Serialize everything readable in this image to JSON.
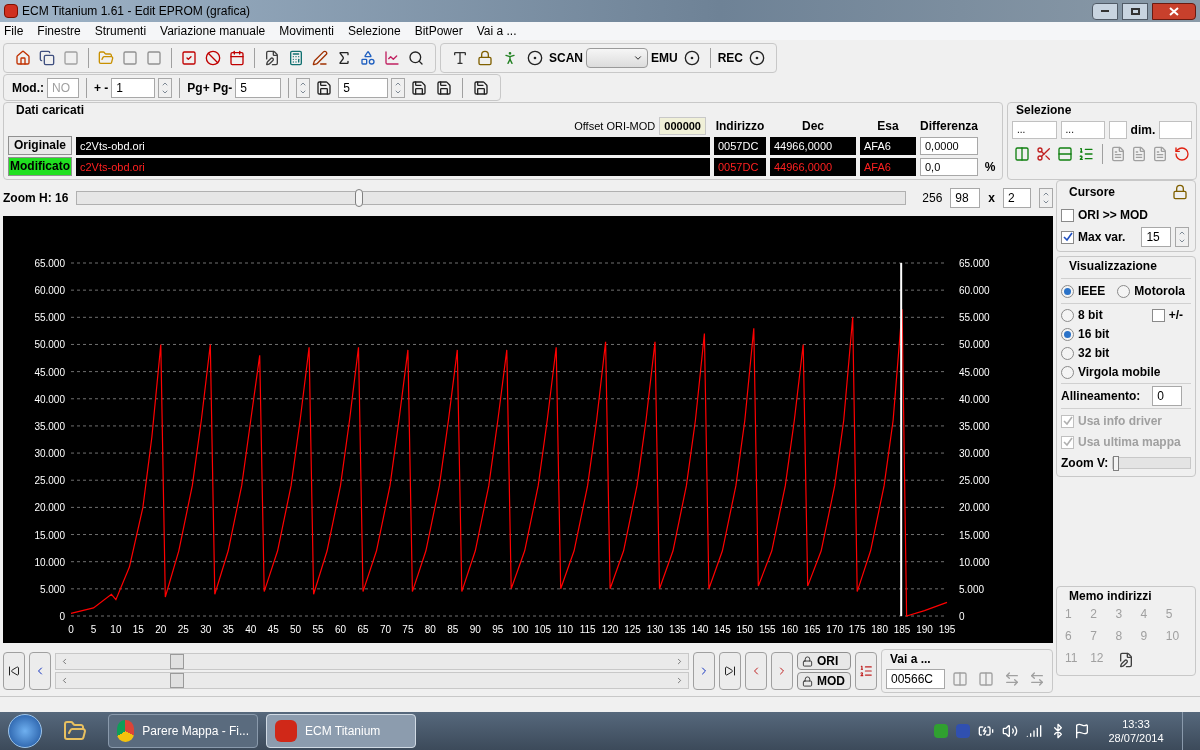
{
  "window": {
    "title": "ECM Titanium 1.61 - Edit EPROM (grafica)"
  },
  "menu": [
    "File",
    "Finestre",
    "Strumenti",
    "Variazione manuale",
    "Movimenti",
    "Selezione",
    "BitPower",
    "Vai a ..."
  ],
  "toolbar": {
    "scan_label": "SCAN",
    "emu_label": "EMU",
    "rec_label": "REC"
  },
  "toolbar2": {
    "mod_label": "Mod.:",
    "mod_value": "NO",
    "step_label": "+ -",
    "step_value": "1",
    "page_label": "Pg+ Pg-",
    "page_value": "5",
    "p_value": "5"
  },
  "loaded": {
    "title": "Dati caricati",
    "offset_label": "Offset ORI-MOD",
    "offset_value": "000000",
    "columns": [
      "Indirizzo",
      "Dec",
      "Esa",
      "Differenza"
    ],
    "rows": [
      {
        "kind": "original",
        "button": "Originale",
        "file": "c2Vts-obd.ori",
        "address": "0057DC",
        "dec": "44966,0000",
        "hex": "AFA6",
        "diff": "0,0000"
      },
      {
        "kind": "modified",
        "button": "Modificato",
        "file": "c2Vts-obd.ori",
        "address": "0057DC",
        "dec": "44966,0000",
        "hex": "AFA6",
        "diff": "0,0",
        "unit": "%"
      }
    ]
  },
  "selection": {
    "title": "Selezione",
    "from": "...",
    "to": "...",
    "dim_label": "dim."
  },
  "zoom": {
    "label": "Zoom H: 16",
    "level": 0.34,
    "max": "256",
    "value": "98",
    "x_label": "x",
    "factor": "2"
  },
  "chart_data": {
    "type": "line",
    "x": [
      0,
      5,
      9,
      10,
      13,
      16,
      18,
      20,
      21,
      24,
      27,
      29,
      31,
      32,
      35,
      38,
      40,
      42,
      43,
      46,
      49,
      51,
      53,
      54,
      57,
      60,
      62,
      64,
      65,
      68,
      71,
      73,
      75,
      76,
      79,
      82,
      84,
      86,
      87,
      90,
      93,
      95,
      97,
      98,
      101,
      104,
      106,
      108,
      109,
      112,
      115,
      117,
      119,
      120,
      123,
      126,
      128,
      130,
      131,
      134,
      137,
      139,
      141,
      142,
      145,
      148,
      150,
      152,
      153,
      156,
      159,
      161,
      163,
      164,
      167,
      170,
      172,
      174,
      175,
      178,
      181,
      183,
      185,
      186,
      190,
      195
    ],
    "series": [
      {
        "color": "#ff0000",
        "values": [
          500,
          1500,
          4000,
          3000,
          9000,
          20000,
          33000,
          50000,
          3500,
          12000,
          24000,
          36000,
          50000,
          4000,
          12000,
          24000,
          36000,
          48000,
          4500,
          12000,
          24000,
          36000,
          49500,
          4000,
          12000,
          24000,
          36000,
          49500,
          4500,
          12000,
          24000,
          36000,
          49000,
          4500,
          12000,
          24000,
          36000,
          49000,
          4500,
          12000,
          24000,
          36000,
          49000,
          5000,
          12000,
          24000,
          36000,
          49500,
          5000,
          12000,
          24000,
          36000,
          50500,
          5000,
          12000,
          24000,
          36000,
          50500,
          5000,
          12000,
          24000,
          36000,
          52000,
          5000,
          12000,
          24000,
          36000,
          53000,
          5500,
          12000,
          24000,
          36000,
          50000,
          5500,
          12000,
          24000,
          36000,
          55000,
          4500,
          12000,
          24000,
          36000,
          56500,
          0,
          1000,
          2500
        ]
      }
    ],
    "xlim": [
      0,
      195
    ],
    "ylim": [
      0,
      65000
    ],
    "xticks": [
      0,
      5,
      10,
      15,
      20,
      25,
      30,
      35,
      40,
      45,
      50,
      55,
      60,
      65,
      70,
      75,
      80,
      85,
      90,
      95,
      100,
      105,
      110,
      115,
      120,
      125,
      130,
      135,
      140,
      145,
      150,
      155,
      160,
      165,
      170,
      175,
      180,
      185,
      190,
      195
    ],
    "yticks": [
      {
        "value": 0,
        "label": "0"
      },
      {
        "value": 5000,
        "label": "5.000"
      },
      {
        "value": 10000,
        "label": "10.000"
      },
      {
        "value": 15000,
        "label": "15.000"
      },
      {
        "value": 20000,
        "label": "20.000"
      },
      {
        "value": 25000,
        "label": "25.000"
      },
      {
        "value": 30000,
        "label": "30.000"
      },
      {
        "value": 35000,
        "label": "35.000"
      },
      {
        "value": 40000,
        "label": "40.000"
      },
      {
        "value": 45000,
        "label": "45.000"
      },
      {
        "value": 50000,
        "label": "50.000"
      },
      {
        "value": 55000,
        "label": "55.000"
      },
      {
        "value": 60000,
        "label": "60.000"
      },
      {
        "value": 65000,
        "label": "65.000"
      }
    ],
    "grid": true,
    "ref_lines": [
      {
        "axis": "x",
        "value": 184.8,
        "color": "#ffffff"
      }
    ]
  },
  "cursor_panel": {
    "title": "Cursore",
    "options": [
      {
        "label": "ORI >> MOD",
        "checked": false
      },
      {
        "label": "Max var.",
        "checked": true
      }
    ],
    "max_var": "15"
  },
  "display": {
    "title": "Visualizzazione",
    "byte_order": [
      {
        "label": "IEEE",
        "selected": true
      },
      {
        "label": "Motorola",
        "selected": false
      }
    ],
    "formats": [
      {
        "label": "8 bit",
        "selected": false
      },
      {
        "label": "16 bit",
        "selected": true
      },
      {
        "label": "32 bit",
        "selected": false
      },
      {
        "label": "Virgola mobile",
        "selected": false
      }
    ],
    "sign": {
      "label": "+/-",
      "checked": false
    },
    "align_label": "Allineamento:",
    "align_value": "0",
    "driver_options": [
      {
        "label": "Usa info driver",
        "checked": true,
        "disabled": true
      },
      {
        "label": "Usa ultima mappa",
        "checked": true,
        "disabled": true
      }
    ],
    "zoom_v": {
      "label": "Zoom V:",
      "level": 0
    }
  },
  "memo": {
    "title": "Memo indirizzi",
    "slots": [
      "1",
      "2",
      "3",
      "4",
      "5",
      "6",
      "7",
      "8",
      "9",
      "10",
      "11",
      "12"
    ]
  },
  "nav": {
    "ori_button": "ORI",
    "mod_button": "MOD"
  },
  "goto": {
    "label": "Vai a ...",
    "value": "00566C"
  },
  "taskbar": {
    "items": [
      {
        "label": "Parere Mappa - Fi...",
        "selected": false
      },
      {
        "label": "ECM Titanium",
        "selected": true
      }
    ],
    "time": "13:33",
    "date": "28/07/2014"
  }
}
